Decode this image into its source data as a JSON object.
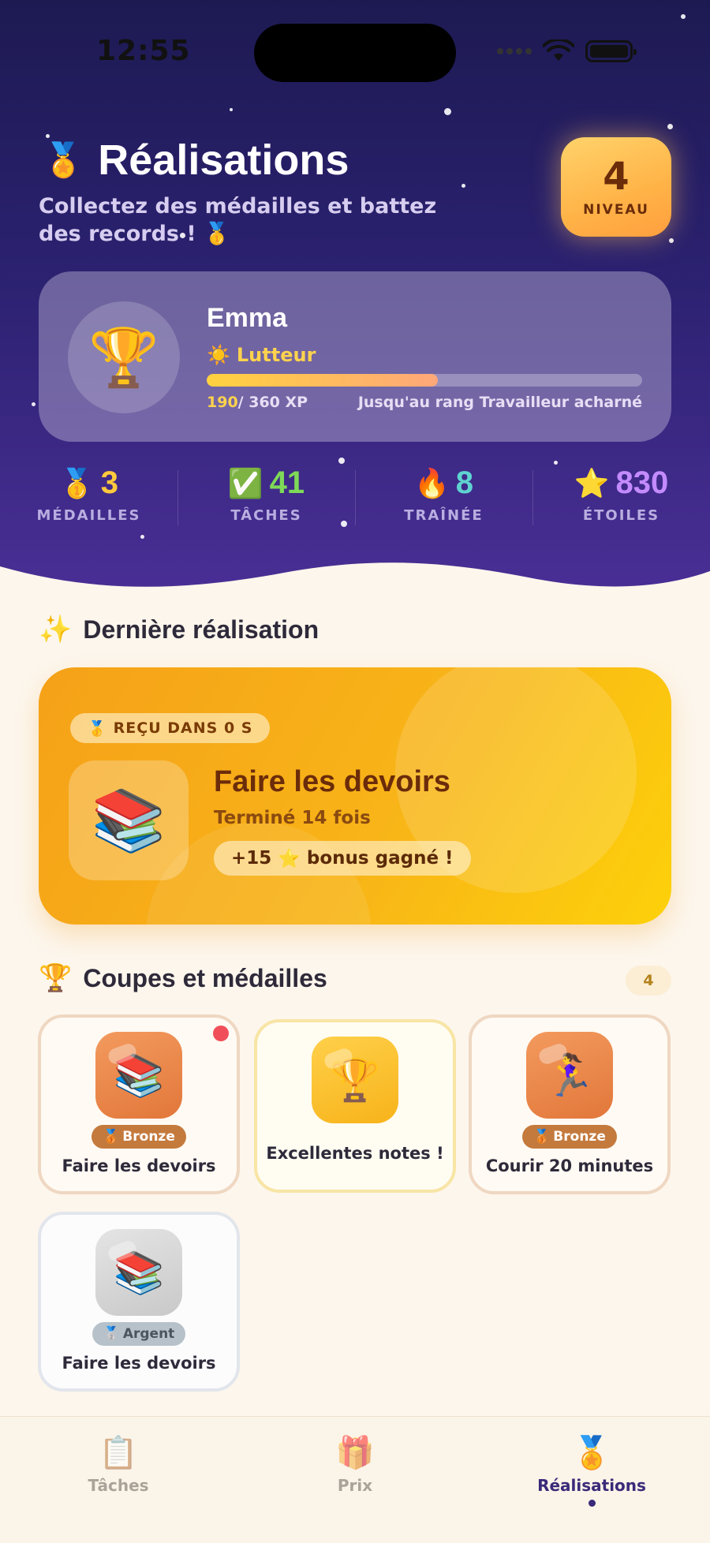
{
  "status_bar": {
    "time": "12:55",
    "icons": [
      "signal-icon",
      "wifi-icon",
      "battery-icon"
    ]
  },
  "header": {
    "icon": "medal-ribbon-icon",
    "title": "Réalisations",
    "subtitle": "Collectez des médailles et battez des records ! 🥇",
    "level": {
      "value": "4",
      "label": "NIVEAU"
    }
  },
  "profile": {
    "name": "Emma",
    "rank_icon": "☀️",
    "rank": "Lutteur",
    "xp_current": "190",
    "xp_total": "/ 360 XP",
    "xp_progress": 0.53,
    "next_rank": "Jusqu'au rang Travailleur acharné"
  },
  "stats": [
    {
      "emoji": "🥇",
      "value": "3",
      "label": "MÉDAILLES",
      "color": "#ffc93c"
    },
    {
      "emoji": "✅",
      "value": "41",
      "label": "TÂCHES",
      "color": "#7ed957"
    },
    {
      "emoji": "🔥",
      "value": "8",
      "label": "TRAÎNÉE",
      "color": "#5fd3d0"
    },
    {
      "emoji": "⭐",
      "value": "830",
      "label": "ÉTOILES",
      "color": "#c48bff"
    }
  ],
  "latest": {
    "heading_icon": "✨",
    "heading": "Dernière réalisation",
    "badge_icon": "🥇",
    "badge": "REÇU DANS 0 S",
    "icon": "📚",
    "title": "Faire les devoirs",
    "subtitle": "Terminé 14 fois",
    "bonus_prefix": "+15",
    "bonus_icon": "⭐",
    "bonus_suffix": "bonus gagné !"
  },
  "medals": {
    "heading_icon": "🏆",
    "heading": "Coupes et médailles",
    "count": "4",
    "items": [
      {
        "icon": "📚",
        "tier": "Bronze",
        "tier_icon": "🥉",
        "name": "Faire les devoirs",
        "new": true
      },
      {
        "icon": "🏆",
        "tier": "",
        "tier_icon": "",
        "name": "Excellentes notes !",
        "new": false
      },
      {
        "icon": "🏃‍♀️",
        "tier": "Bronze",
        "tier_icon": "🥉",
        "name": "Courir 20 minutes",
        "new": false
      },
      {
        "icon": "📚",
        "tier": "Argent",
        "tier_icon": "🥈",
        "name": "Faire les devoirs",
        "new": false
      }
    ]
  },
  "tabbar": {
    "items": [
      {
        "icon": "📋",
        "label": "Tâches"
      },
      {
        "icon": "🎁",
        "label": "Prix"
      },
      {
        "icon": "🏅",
        "label": "Réalisations"
      }
    ],
    "active": 2
  }
}
